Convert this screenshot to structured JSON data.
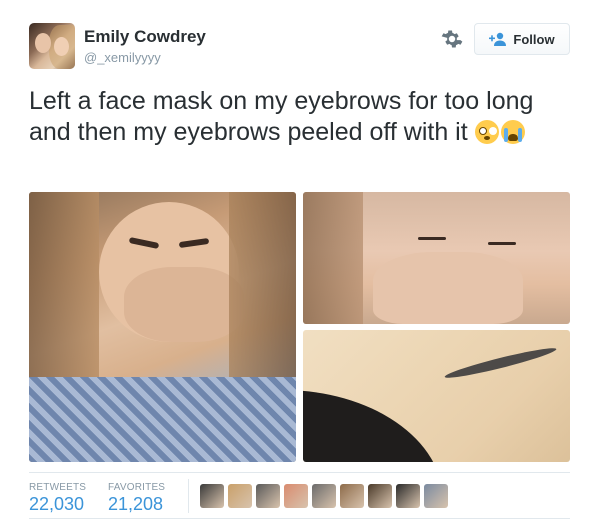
{
  "user": {
    "name": "Emily Cowdrey",
    "handle": "@_xemilyyyy"
  },
  "actions": {
    "follow_label": "Follow",
    "settings_icon": "gear-icon",
    "follow_icon": "add-user-icon"
  },
  "tweet": {
    "text": "Left a face mask on my eyebrows for too long and then my eyebrows peeled off with it",
    "emojis": [
      "flushed-face",
      "crying-face"
    ]
  },
  "stats": {
    "retweets_label": "RETWEETS",
    "retweets_value": "22,030",
    "favorites_label": "FAVORITES",
    "favorites_value": "21,208"
  },
  "favoriters": [
    {
      "name": "favoriter-avatar-1",
      "color": "#3a3a3a"
    },
    {
      "name": "favoriter-avatar-2",
      "color": "#c9a06a"
    },
    {
      "name": "favoriter-avatar-3",
      "color": "#5a5a5a"
    },
    {
      "name": "favoriter-avatar-4",
      "color": "#d98b6f"
    },
    {
      "name": "favoriter-avatar-5",
      "color": "#6b6b6b"
    },
    {
      "name": "favoriter-avatar-6",
      "color": "#8d6b4a"
    },
    {
      "name": "favoriter-avatar-7",
      "color": "#4a3a2a"
    },
    {
      "name": "favoriter-avatar-8",
      "color": "#2a2a2a"
    },
    {
      "name": "favoriter-avatar-9",
      "color": "#7a8aa0"
    }
  ],
  "colors": {
    "link_blue": "#3b94d9",
    "text_dark": "#292f33",
    "text_muted": "#8899a6",
    "border": "#e1e8ed"
  }
}
